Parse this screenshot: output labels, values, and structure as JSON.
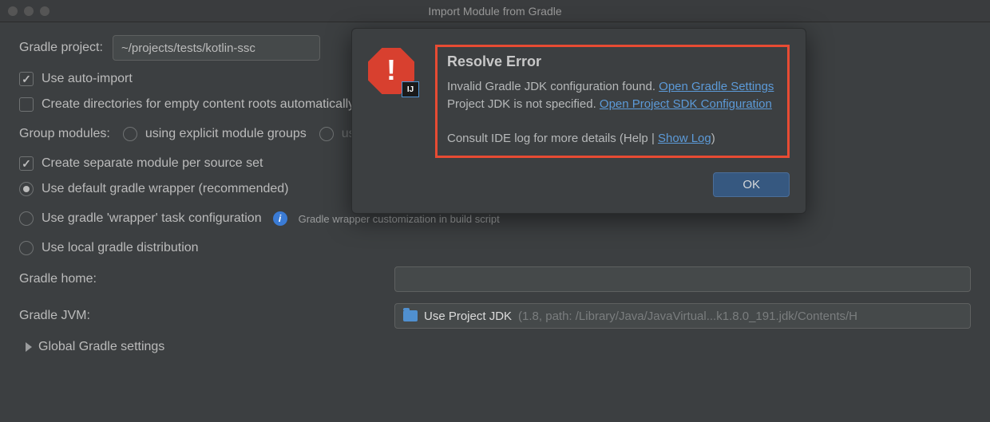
{
  "window": {
    "title": "Import Module from Gradle"
  },
  "form": {
    "project_label": "Gradle project:",
    "project_path": "~/projects/tests/kotlin-ssc",
    "auto_import_label": "Use auto-import",
    "create_dirs_label": "Create directories for empty content roots automatically",
    "group_modules_label": "Group modules:",
    "group_explicit": "using explicit module groups",
    "group_qualified": "using qualified names",
    "create_separate_label": "Create separate module per source set",
    "wrapper_default": "Use default gradle wrapper (recommended)",
    "wrapper_task": "Use gradle 'wrapper' task configuration",
    "wrapper_hint": "Gradle wrapper customization in build script",
    "local_dist": "Use local gradle distribution",
    "gradle_home_label": "Gradle home:",
    "gradle_jvm_label": "Gradle JVM:",
    "jvm_name": "Use Project JDK",
    "jvm_detail": " (1.8, path: /Library/Java/JavaVirtual...k1.8.0_191.jdk/Contents/H",
    "global_settings": "Global Gradle settings"
  },
  "dialog": {
    "title": "Resolve Error",
    "msg1_a": "Invalid Gradle JDK configuration found. ",
    "link1": "Open Gradle Settings",
    "msg2_a": "Project JDK is not specified. ",
    "link2": "Open Project SDK Configuration",
    "msg3_a": "Consult IDE log for more details (Help | ",
    "link3": "Show Log",
    "msg3_b": ")",
    "ok": "OK",
    "ij_badge": "IJ"
  }
}
